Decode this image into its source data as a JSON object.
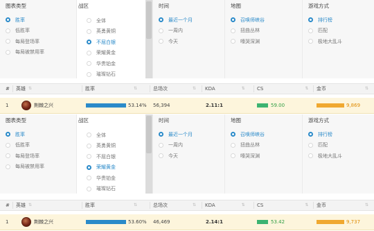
{
  "panels": [
    {
      "filters": {
        "chart_type": {
          "header": "图表类型",
          "options": [
            "胜率",
            "低胜率",
            "每局登场率",
            "每局被禁用率"
          ],
          "selected": 0
        },
        "region": {
          "header": "战区",
          "options": [
            "全体",
            "英勇黄铜",
            "不屈白银",
            "荣耀黄金",
            "华贵铂金",
            "璀璨钻石"
          ],
          "selected": 2
        },
        "time": {
          "header": "时间",
          "options": [
            "最近一个月",
            "一周内",
            "今天"
          ],
          "selected": 0
        },
        "map": {
          "header": "地图",
          "options": [
            "召唤师峡谷",
            "扭曲丛林",
            "嚎哭深渊"
          ],
          "selected": 0
        },
        "mode": {
          "header": "游戏方式",
          "options": [
            "排行榜",
            "匹配",
            "极地大乱斗"
          ],
          "selected": 0
        }
      },
      "table": {
        "headers": [
          "#",
          "英雄",
          "胜率",
          "总场次",
          "KDA",
          "CS",
          "金币"
        ],
        "row": {
          "rank": "1",
          "hero": "荆棘之兴",
          "winrate": "53.14%",
          "winrate_fraction": 0.5314,
          "games": "56,394",
          "kda": "2.11:1",
          "cs": "59.00",
          "gold": "9,869"
        }
      }
    },
    {
      "filters": {
        "chart_type": {
          "header": "图表类型",
          "options": [
            "胜率",
            "低胜率",
            "每局登场率",
            "每局被禁用率"
          ],
          "selected": 0
        },
        "region": {
          "header": "战区",
          "options": [
            "全体",
            "英勇黄铜",
            "不屈白银",
            "荣耀黄金",
            "华贵铂金",
            "璀璨钻石"
          ],
          "selected": 3
        },
        "time": {
          "header": "时间",
          "options": [
            "最近一个月",
            "一周内",
            "今天"
          ],
          "selected": 0
        },
        "map": {
          "header": "地图",
          "options": [
            "召唤师峡谷",
            "扭曲丛林",
            "嚎哭深渊"
          ],
          "selected": 0
        },
        "mode": {
          "header": "游戏方式",
          "options": [
            "排行榜",
            "匹配",
            "极地大乱斗"
          ],
          "selected": 0
        }
      },
      "table": {
        "headers": [
          "#",
          "英雄",
          "胜率",
          "总场次",
          "KDA",
          "CS",
          "金币"
        ],
        "row": {
          "rank": "1",
          "hero": "荆棘之兴",
          "winrate": "53.60%",
          "winrate_fraction": 0.536,
          "games": "46,469",
          "kda": "2.14:1",
          "cs": "53.42",
          "gold": "9,737"
        }
      }
    }
  ],
  "colors": {
    "accent": "#2a8ac9",
    "winrate_bar": "#2a8ac9",
    "cs_bar": "#3cb371",
    "cs_text": "#2f9e44",
    "gold_bar": "#f0a830",
    "gold_text": "#e08a00",
    "row_highlight": "#fdf5dc"
  },
  "icons": {
    "radio_selected": "radio-selected-icon",
    "radio_unselected": "radio-unselected-icon",
    "sort": "sort-icon",
    "hero_avatar": "hero-portrait"
  }
}
